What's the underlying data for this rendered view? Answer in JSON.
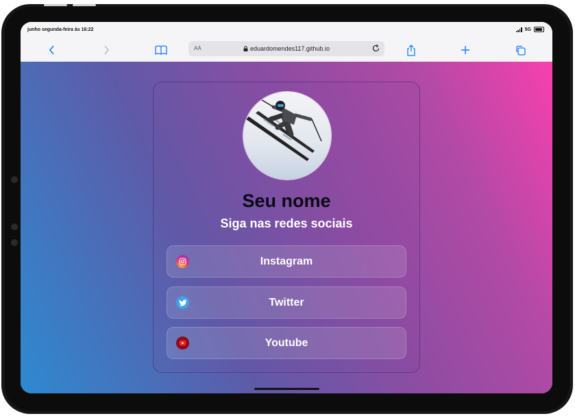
{
  "status_bar": {
    "time": "junho segunda-feira às 16:22",
    "network": "5G"
  },
  "browser": {
    "url_aa": "AA",
    "url": "eduardomendes117.github.io",
    "icons": [
      "back-icon",
      "forward-icon",
      "bookmarks-icon",
      "lock-icon",
      "reload-icon",
      "share-icon",
      "new-tab-icon",
      "tabs-icon"
    ]
  },
  "profile": {
    "name": "Seu nome",
    "tagline": "Siga nas redes sociais"
  },
  "links": [
    {
      "label": "Instagram",
      "icon": "instagram-icon"
    },
    {
      "label": "Twitter",
      "icon": "twitter-icon"
    },
    {
      "label": "Youtube",
      "icon": "youtube-icon"
    }
  ],
  "colors": {
    "gradient_start": "#2d8ad0",
    "gradient_end": "#f740ae",
    "name_color": "#0a0a14"
  }
}
